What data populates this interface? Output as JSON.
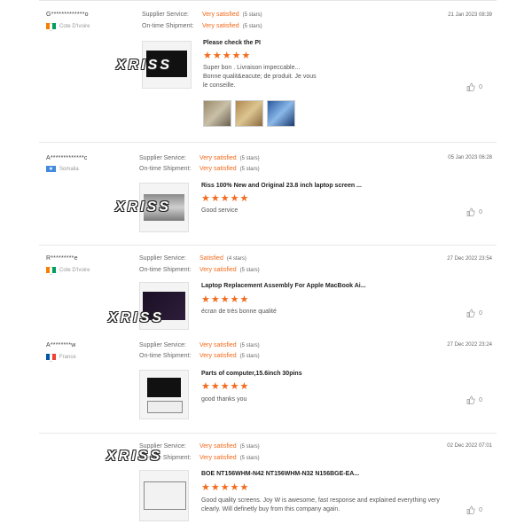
{
  "labels": {
    "supplier_service": "Supplier Service:",
    "ontime_shipment": "On-time Shipment:"
  },
  "watermark": "XRISS",
  "reviews": [
    {
      "user": "G*************o",
      "country": "Cote D'Ivoire",
      "flag": [
        "#f77f00",
        "#ffffff",
        "#009e60"
      ],
      "supplier_value": "Very satisfied",
      "supplier_stars": "(5 stars)",
      "shipment_value": "Very satisfied",
      "shipment_stars": "(5 stars)",
      "date": "21 Jan 2023 08:39",
      "title": "Please check the PI",
      "stars": "★★★★★",
      "text": "Super bon . Livraison impeccable... Bonne qualit&eacute; de produit. Je vous le conseille.",
      "likes": "0"
    },
    {
      "user": "A*************c",
      "country": "Somalia",
      "flag": [
        "#4189dd",
        "#4189dd",
        "#4189dd"
      ],
      "supplier_value": "Very satisfied",
      "supplier_stars": "(5 stars)",
      "shipment_value": "Very satisfied",
      "shipment_stars": "(5 stars)",
      "date": "05 Jan 2023 06:28",
      "title": "Riss 100% New and Original 23.8 inch laptop screen ...",
      "stars": "★★★★★",
      "text": "Good service",
      "likes": "0"
    },
    {
      "user": "R*********e",
      "country": "Cote D'Ivoire",
      "flag": [
        "#f77f00",
        "#ffffff",
        "#009e60"
      ],
      "supplier_value": "Satisfied",
      "supplier_stars": "(4 stars)",
      "shipment_value": "Very satisfied",
      "shipment_stars": "(5 stars)",
      "date": "27 Dec 2022 23:54",
      "title": "Laptop Replacement Assembly For Apple MacBook Ai...",
      "stars": "★★★★★",
      "text": "écran de très bonne qualité",
      "likes": "0"
    },
    {
      "user": "A********w",
      "country": "France",
      "flag": [
        "#0055a4",
        "#ffffff",
        "#ef4135"
      ],
      "supplier_value": "Very satisfied",
      "supplier_stars": "(5 stars)",
      "shipment_value": "Very satisfied",
      "shipment_stars": "(5 stars)",
      "date": "27 Dec 2022 23:24",
      "title": "Parts of computer,15.6inch 30pins",
      "stars": "★★★★★",
      "text": "good thanks you",
      "likes": "0"
    },
    {
      "supplier_value": "Very satisfied",
      "supplier_stars": "(5 stars)",
      "shipment_value": "Very satisfied",
      "shipment_stars": "(5 stars)",
      "date": "02 Dec 2022 07:01",
      "title": "BOE NT156WHM-N42 NT156WHM-N32 N156BGE-EA...",
      "stars": "★★★★★",
      "text": "Good quality screens. Joy W is awesome, fast response and explained everything very clearly. Will definetly buy from this company again.",
      "likes": "0"
    }
  ]
}
